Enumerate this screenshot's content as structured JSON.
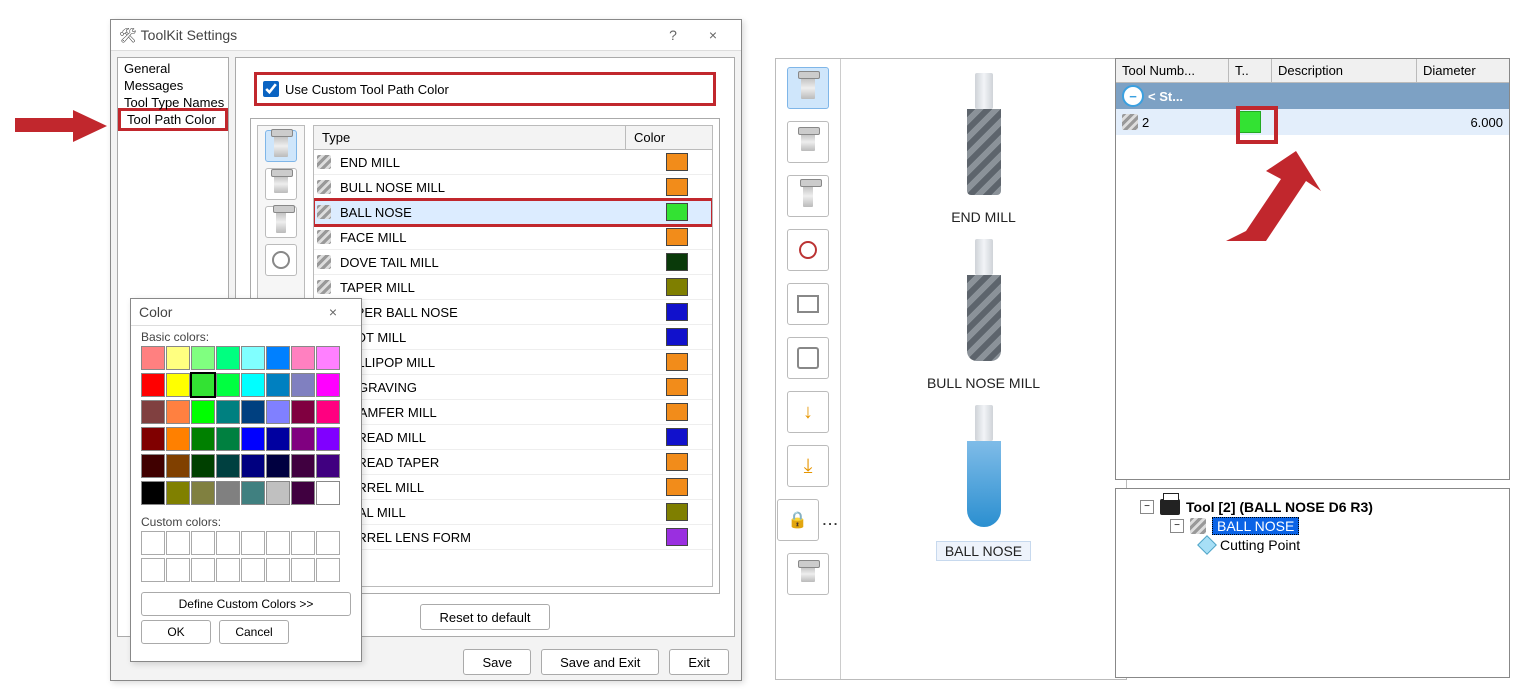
{
  "dialog": {
    "title": "ToolKit Settings",
    "help": "?",
    "close": "×",
    "nav": [
      "General",
      "Messages",
      "Tool Type Names",
      "Tool Path Color"
    ],
    "nav_selected": 3,
    "checkbox_label": "Use Custom Tool Path Color",
    "header_type": "Type",
    "header_color": "Color",
    "rows": [
      {
        "name": "END MILL",
        "color": "#f28c1a"
      },
      {
        "name": "BULL NOSE MILL",
        "color": "#f28c1a"
      },
      {
        "name": "BALL NOSE",
        "color": "#33e233",
        "highlight": true,
        "selected": true
      },
      {
        "name": "FACE MILL",
        "color": "#f28c1a"
      },
      {
        "name": "DOVE TAIL MILL",
        "color": "#0a3a0a"
      },
      {
        "name": "TAPER MILL",
        "color": "#7f7f00"
      },
      {
        "name": "TAPER BALL NOSE",
        "color": "#1111cc"
      },
      {
        "name": "SLOT MILL",
        "color": "#1111cc"
      },
      {
        "name": "LOLLIPOP MILL",
        "color": "#f28c1a"
      },
      {
        "name": "ENGRAVING",
        "color": "#f28c1a"
      },
      {
        "name": "CHAMFER MILL",
        "color": "#f28c1a"
      },
      {
        "name": "THREAD MILL",
        "color": "#1111cc"
      },
      {
        "name": "THREAD TAPER",
        "color": "#f28c1a"
      },
      {
        "name": "BARREL MILL",
        "color": "#f28c1a"
      },
      {
        "name": "OVAL MILL",
        "color": "#7f7f00"
      },
      {
        "name": "BARREL LENS FORM",
        "color": "#9a2fe0"
      }
    ],
    "reset": "Reset to default",
    "save": "Save",
    "save_exit": "Save and Exit",
    "exit": "Exit"
  },
  "colordlg": {
    "title": "Color",
    "close": "×",
    "basic_label": "Basic colors:",
    "custom_label": "Custom colors:",
    "define": "Define Custom Colors >>",
    "ok": "OK",
    "cancel": "Cancel",
    "basic": [
      "#ff8080",
      "#ffff80",
      "#80ff80",
      "#00ff80",
      "#80ffff",
      "#0080ff",
      "#ff80c0",
      "#ff80ff",
      "#ff0000",
      "#ffff00",
      "#33e233",
      "#00ff40",
      "#00ffff",
      "#0080c0",
      "#8080c0",
      "#ff00ff",
      "#804040",
      "#ff8040",
      "#00ff00",
      "#008080",
      "#004080",
      "#8080ff",
      "#800040",
      "#ff0080",
      "#800000",
      "#ff8000",
      "#008000",
      "#008040",
      "#0000ff",
      "#0000a0",
      "#800080",
      "#8000ff",
      "#400000",
      "#804000",
      "#004000",
      "#004040",
      "#000080",
      "#000040",
      "#400040",
      "#400080",
      "#000000",
      "#808000",
      "#808040",
      "#808080",
      "#408080",
      "#c0c0c0",
      "#400040",
      "#ffffff"
    ],
    "selected_index": 10
  },
  "preview": {
    "labels": [
      "END MILL",
      "BULL NOSE MILL",
      "BALL NOSE"
    ]
  },
  "grid": {
    "headers": [
      "Tool Numb...",
      "T..",
      "Description",
      "Diameter"
    ],
    "row1_label": "< St...",
    "row2_num": "2",
    "row2_dia": "6.000"
  },
  "tree": {
    "root": "Tool [2] (BALL NOSE D6 R3)",
    "child1": "BALL NOSE",
    "child2": "Cutting Point"
  }
}
